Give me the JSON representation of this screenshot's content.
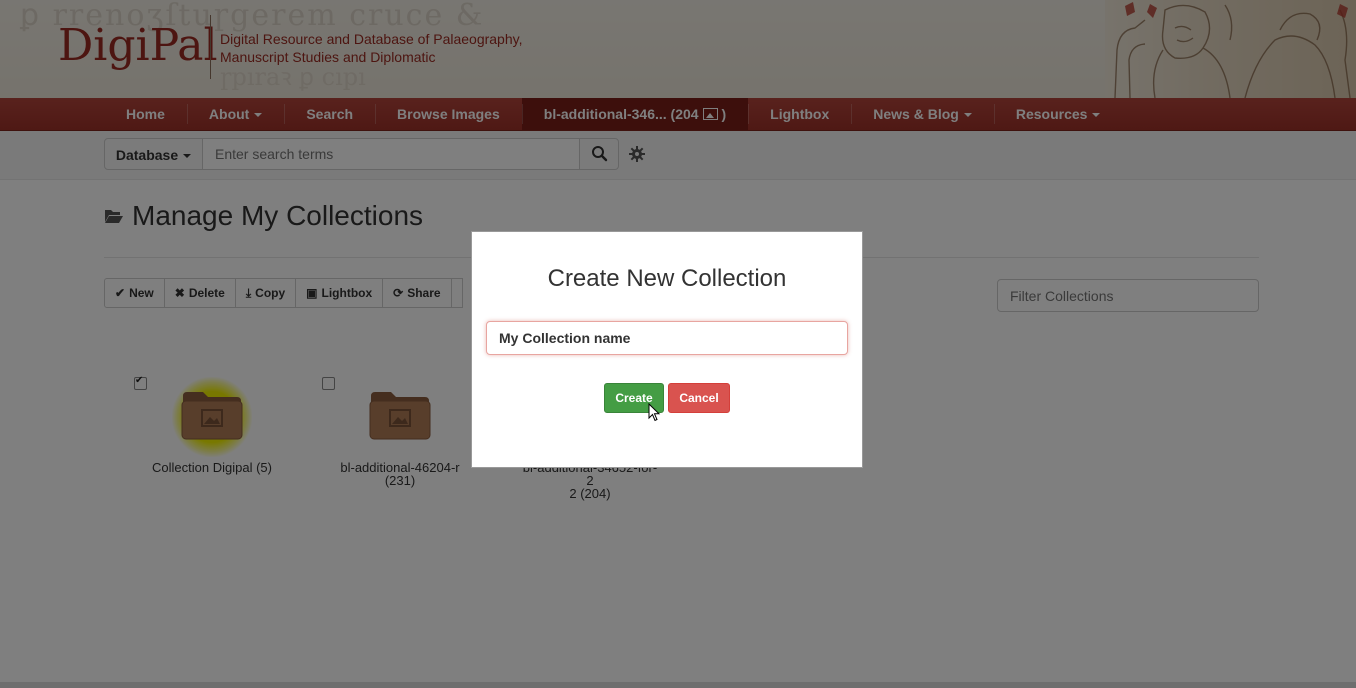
{
  "header": {
    "logo": "DigiPal",
    "tagline_line1": "Digital Resource and Database of Palaeography,",
    "tagline_line2": "Manuscript Studies and Diplomatic"
  },
  "nav": {
    "items": [
      {
        "label": "Home"
      },
      {
        "label": "About",
        "dropdown": true
      },
      {
        "label": "Search"
      },
      {
        "label": "Browse Images"
      },
      {
        "label": "bl-additional-346... (204",
        "suffix": ")",
        "active": true
      },
      {
        "label": "Lightbox"
      },
      {
        "label": "News & Blog",
        "dropdown": true
      },
      {
        "label": "Resources",
        "dropdown": true
      }
    ]
  },
  "search": {
    "scope_label": "Database",
    "placeholder": "Enter search terms"
  },
  "page": {
    "title": "Manage My Collections"
  },
  "toolbar": {
    "new_label": "New",
    "delete_label": "Delete",
    "copy_label": "Copy",
    "lightbox_label": "Lightbox",
    "share_label": "Share"
  },
  "filter": {
    "placeholder": "Filter Collections"
  },
  "collections": [
    {
      "line1": "Collection Digipal (5)",
      "line2": "",
      "checked": true
    },
    {
      "line1": "bl-additional-46204-r",
      "line2": "(231)",
      "checked": false
    },
    {
      "line1": "bl-additional-34652-for-2",
      "line2": "2 (204)",
      "checked": false
    }
  ],
  "modal": {
    "title": "Create New Collection",
    "input_value": "My Collection name",
    "create_label": "Create",
    "cancel_label": "Cancel"
  },
  "colors": {
    "brand_red": "#9b2b22",
    "nav_red": "#a93a31",
    "create_green": "#449d44",
    "cancel_red": "#d9534f",
    "selection_yellow": "#f1f100",
    "folder_brown": "#b07d57"
  }
}
